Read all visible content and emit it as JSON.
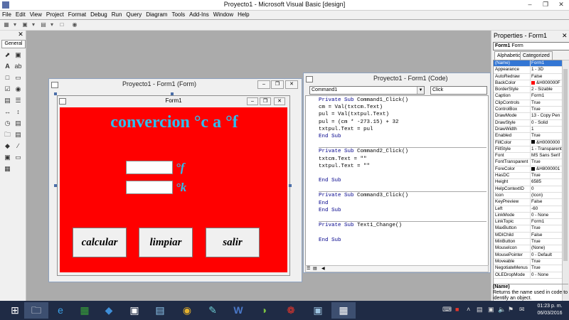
{
  "window": {
    "title": "Proyecto1 - Microsoft Visual Basic [design]"
  },
  "menu": [
    "File",
    "Edit",
    "View",
    "Project",
    "Format",
    "Debug",
    "Run",
    "Query",
    "Diagram",
    "Tools",
    "Add-Ins",
    "Window",
    "Help"
  ],
  "toolbox": {
    "tab": "General"
  },
  "form_window": {
    "title": "Proyecto1 - Form1 (Form)",
    "form_caption": "Form1",
    "heading": "convercion °c a °f",
    "unit_f": "°f",
    "unit_k": "°k",
    "buttons": [
      "calcular",
      "limpiar",
      "salir"
    ],
    "backcolor": "#ff0000",
    "accent": "#2dbff0"
  },
  "code_window": {
    "title": "Proyecto1 - Form1 (Code)",
    "object": "Command1",
    "procedure": "Click",
    "lines": [
      [
        "Private Sub ",
        "Command1_Click()"
      ],
      [
        "",
        "cm = Val(txtcm.Text)"
      ],
      [
        "",
        "pul = Val(txtpul.Text)"
      ],
      [
        "",
        "pul = (cm * -273.15) + 32"
      ],
      [
        "",
        "txtpul.Text = pul"
      ],
      [
        "End Sub",
        ""
      ],
      [
        "",
        ""
      ],
      [
        "Private Sub ",
        "Command2_Click()"
      ],
      [
        "",
        "txtcm.Text = \"\""
      ],
      [
        "",
        "txtpul.Text = \"\""
      ],
      [
        "",
        ""
      ],
      [
        "End Sub",
        ""
      ],
      [
        "",
        ""
      ],
      [
        "Private Sub ",
        "Command3_Click()"
      ],
      [
        "End",
        ""
      ],
      [
        "End Sub",
        ""
      ],
      [
        "",
        ""
      ],
      [
        "Private Sub ",
        "Text1_Change()"
      ],
      [
        "",
        ""
      ],
      [
        "End Sub",
        ""
      ]
    ]
  },
  "properties": {
    "title": "Properties - Form1",
    "object": "Form1",
    "object_type": "Form",
    "tabs": [
      "Alphabetic",
      "Categorized"
    ],
    "rows": [
      [
        "(Name)",
        "Form1"
      ],
      [
        "Appearance",
        "1 - 3D"
      ],
      [
        "AutoRedraw",
        "False"
      ],
      [
        "BackColor",
        "&H000000F"
      ],
      [
        "BorderStyle",
        "2 - Sizable"
      ],
      [
        "Caption",
        "Form1"
      ],
      [
        "ClipControls",
        "True"
      ],
      [
        "ControlBox",
        "True"
      ],
      [
        "DrawMode",
        "13 - Copy Pen"
      ],
      [
        "DrawStyle",
        "0 - Solid"
      ],
      [
        "DrawWidth",
        "1"
      ],
      [
        "Enabled",
        "True"
      ],
      [
        "FillColor",
        "&H0000000"
      ],
      [
        "FillStyle",
        "1 - Transparent"
      ],
      [
        "Font",
        "MS Sans Serif"
      ],
      [
        "FontTransparent",
        "True"
      ],
      [
        "ForeColor",
        "&H8000001"
      ],
      [
        "HasDC",
        "True"
      ],
      [
        "Height",
        "6585"
      ],
      [
        "HelpContextID",
        "0"
      ],
      [
        "Icon",
        "(Icon)"
      ],
      [
        "KeyPreview",
        "False"
      ],
      [
        "Left",
        "-60"
      ],
      [
        "LinkMode",
        "0 - None"
      ],
      [
        "LinkTopic",
        "Form1"
      ],
      [
        "MaxButton",
        "True"
      ],
      [
        "MDIChild",
        "False"
      ],
      [
        "MinButton",
        "True"
      ],
      [
        "MouseIcon",
        "(None)"
      ],
      [
        "MousePointer",
        "0 - Default"
      ],
      [
        "Moveable",
        "True"
      ],
      [
        "NegotiateMenus",
        "True"
      ],
      [
        "OLEDropMode",
        "0 - None"
      ]
    ],
    "swatches": {
      "BackColor": "#ff0000",
      "FillColor": "#000000",
      "ForeColor": "#000000"
    },
    "desc_title": "(Name)",
    "desc_text": "Returns the name used in code to identify an object."
  },
  "taskbar": {
    "time": "01:23 p. m.",
    "date": "06/03/2016"
  }
}
